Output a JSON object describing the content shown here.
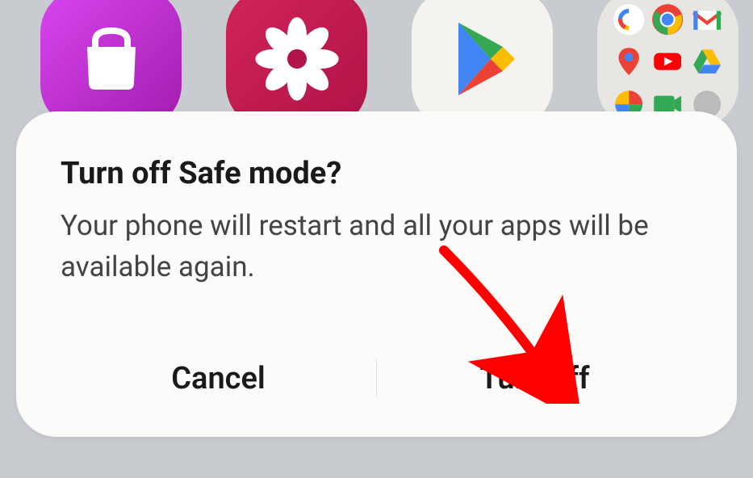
{
  "apps": {
    "shop": "shopping-bag-icon",
    "flower": "gallery-flower-icon",
    "play": "play-store-icon",
    "folder": "google-folder-icon"
  },
  "dialog": {
    "title": "Turn off Safe mode?",
    "message": "Your phone will restart and all your apps will be available again.",
    "cancel_label": "Cancel",
    "confirm_label": "Turn off"
  },
  "annotation": {
    "arrow_color": "#ff0000"
  }
}
